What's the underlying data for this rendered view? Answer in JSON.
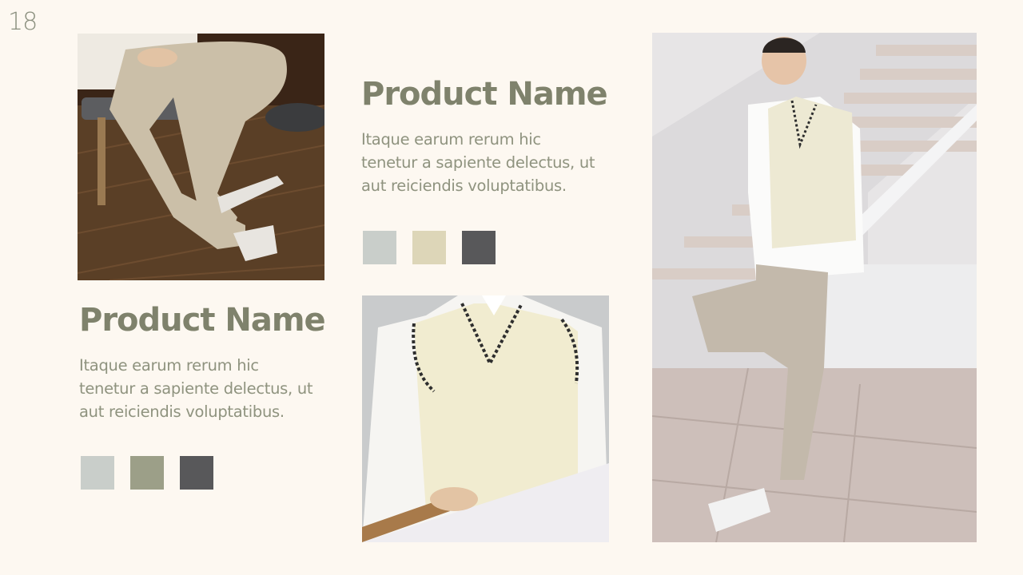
{
  "page_number": "18",
  "products": [
    {
      "title": "Product Name",
      "description_lines": [
        "Itaque earum rerum hic",
        "tenetur a sapiente delectus, ut",
        "aut reiciendis voluptatibus."
      ],
      "swatches": [
        "#c9ceca",
        "#ddd6b8",
        "#58585a"
      ]
    },
    {
      "title": "Product Name",
      "description_lines": [
        "Itaque earum rerum hic",
        "tenetur a sapiente delectus, ut",
        "aut reiciendis voluptatibus."
      ],
      "swatches": [
        "#c9ceca",
        "#9c9f88",
        "#58585a"
      ]
    }
  ],
  "colors": {
    "background": "#fdf8f1",
    "heading": "#7f826c",
    "body_text": "#8f937f"
  }
}
